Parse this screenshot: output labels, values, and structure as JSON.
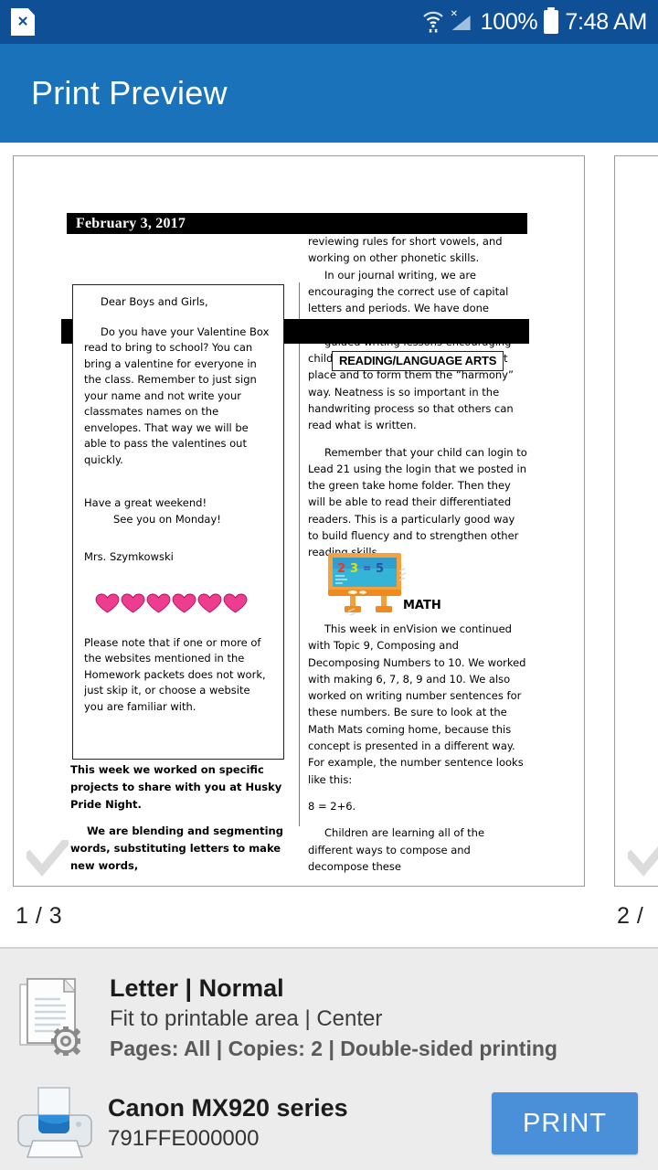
{
  "status_bar": {
    "close_icon": "document-close-icon",
    "wifi_icon": "wifi-icon",
    "signal_icon": "cellular-signal-off-icon",
    "battery_percent": "100%",
    "battery_icon": "battery-full-icon",
    "time": "7:48 AM"
  },
  "app_bar": {
    "title": "Print Preview"
  },
  "preview": {
    "pages": [
      {
        "label": "1 / 3",
        "check_icon": "checkmark-icon"
      },
      {
        "label": "2 /",
        "check_icon": "checkmark-icon"
      }
    ]
  },
  "document": {
    "date_banner": "February 3, 2017",
    "section_chip": "READING/LANGUAGE ARTS",
    "math_heading": "MATH",
    "math_icon": "easel-chalkboard-icon",
    "easel_numbers": [
      "2",
      "3",
      "=",
      "5"
    ],
    "letter": {
      "greeting": "Dear Boys and Girls,",
      "body1": "Do you have your Valentine Box read to bring to school? You can bring a valentine for everyone in the class. Remember to just sign your name and not write your classmates names on the envelopes.  That way we will be able to pass the valentines out quickly.",
      "closing1": "Have a great weekend!",
      "closing2": "See you on Monday!",
      "signature": "Mrs. Szymkowski",
      "hearts_icon": "hearts-row-icon",
      "note": "Please note that if one or more of the websites mentioned in the Homework packets does not work, just skip it, or choose a website you are familiar with."
    },
    "left_lower": {
      "p1": "This week we worked on specific projects to share with you at Husky Pride Night.",
      "p2": "We are blending and segmenting words, substituting letters to make new words,"
    },
    "right_column": {
      "p1": "reviewing rules for short vowels, and working on other phonetic skills.",
      "p2": "In our journal writing, we are encouraging the correct use of capital letters and periods.  We have done several",
      "p3_hidden": "guided writing lessons encouraging children to begin letters in the correct",
      "p4": "place and to form them the “harmony” way.  Neatness is so important in the handwriting process so that others can read what is written.",
      "p5": "Remember that your child can login to Lead 21 using the login that we posted in the green take home folder. Then they will be able to read their differentiated readers.  This is a particularly good way to build fluency and to strengthen other reading skills."
    },
    "math_column": {
      "p1": "This week in enVision we continued with Topic 9, Composing and Decomposing Numbers to 10.  We worked with making 6, 7, 8, 9 and 10.  We also worked on writing number sentences for these numbers. Be sure to look at the Math Mats coming home, because this concept is presented in a different way.  For example, the number sentence looks like this:",
      "equation": "8 = 2+6.",
      "p2": "Children are learning all of the different ways to compose and decompose these"
    }
  },
  "settings": {
    "options_icon": "document-settings-icon",
    "line1": "Letter | Normal",
    "line2": "Fit to printable area | Center",
    "line3": "Pages: All | Copies: 2 | Double-sided printing"
  },
  "printer": {
    "icon": "printer-icon",
    "name": "Canon MX920 series",
    "id": "791FFE000000",
    "print_button": "PRINT"
  },
  "colors": {
    "status_bar": "#0f4f96",
    "app_bar": "#1a73ba",
    "print_button": "#4a90d9",
    "panel_bg": "#ececec",
    "heart": "#ee3d8f"
  }
}
